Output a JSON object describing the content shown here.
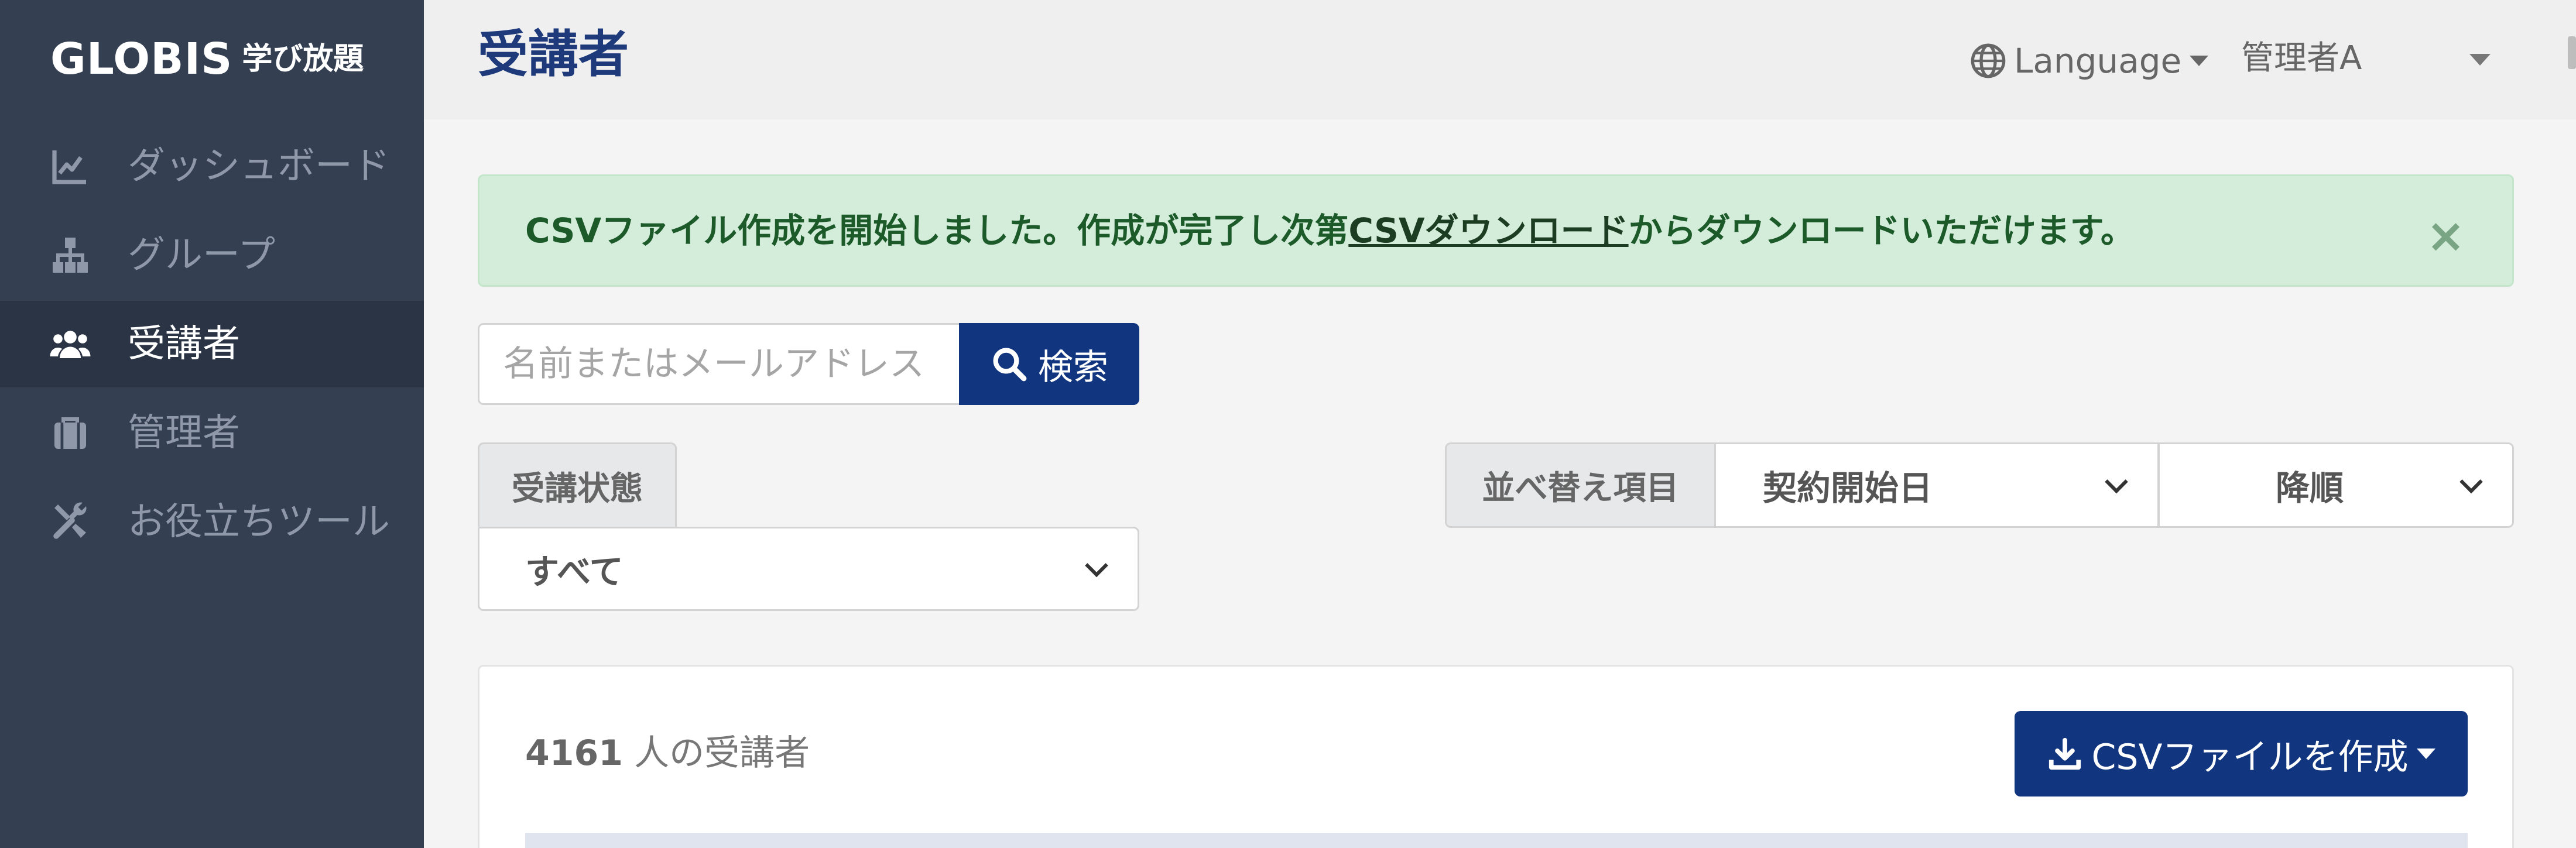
{
  "sidebar": {
    "logo": {
      "word": "GLOBIS",
      "sub": "学び放題"
    },
    "items": [
      {
        "label": "ダッシュボード",
        "icon": "chart-line-icon",
        "active": false
      },
      {
        "label": "グループ",
        "icon": "sitemap-icon",
        "active": false
      },
      {
        "label": "受講者",
        "icon": "users-icon",
        "active": true
      },
      {
        "label": "管理者",
        "icon": "briefcase-icon",
        "active": false
      },
      {
        "label": "お役立ちツール",
        "icon": "tools-icon",
        "active": false
      }
    ]
  },
  "header": {
    "title": "受講者",
    "language_label": "Language",
    "user_label": "管理者A"
  },
  "alert": {
    "text_before": "CSVファイル作成を開始しました。作成が完了し次第",
    "link_text": "CSVダウンロード",
    "text_after": "からダウンロードいただけます。",
    "close_symbol": "×",
    "color": "#d4edda"
  },
  "search": {
    "placeholder": "名前またはメールアドレス",
    "button_label": "検索"
  },
  "filter": {
    "label": "受講状態",
    "selected": "すべて"
  },
  "sort": {
    "label": "並べ替え項目",
    "field_selected": "契約開始日",
    "order_selected": "降順"
  },
  "card": {
    "count_value": "4161",
    "count_suffix": " 人の受講者",
    "csv_button_label": "CSVファイルを作成"
  },
  "colors": {
    "sidebar": "#343f52",
    "accent": "#11357f",
    "title": "#1e3a7b"
  }
}
